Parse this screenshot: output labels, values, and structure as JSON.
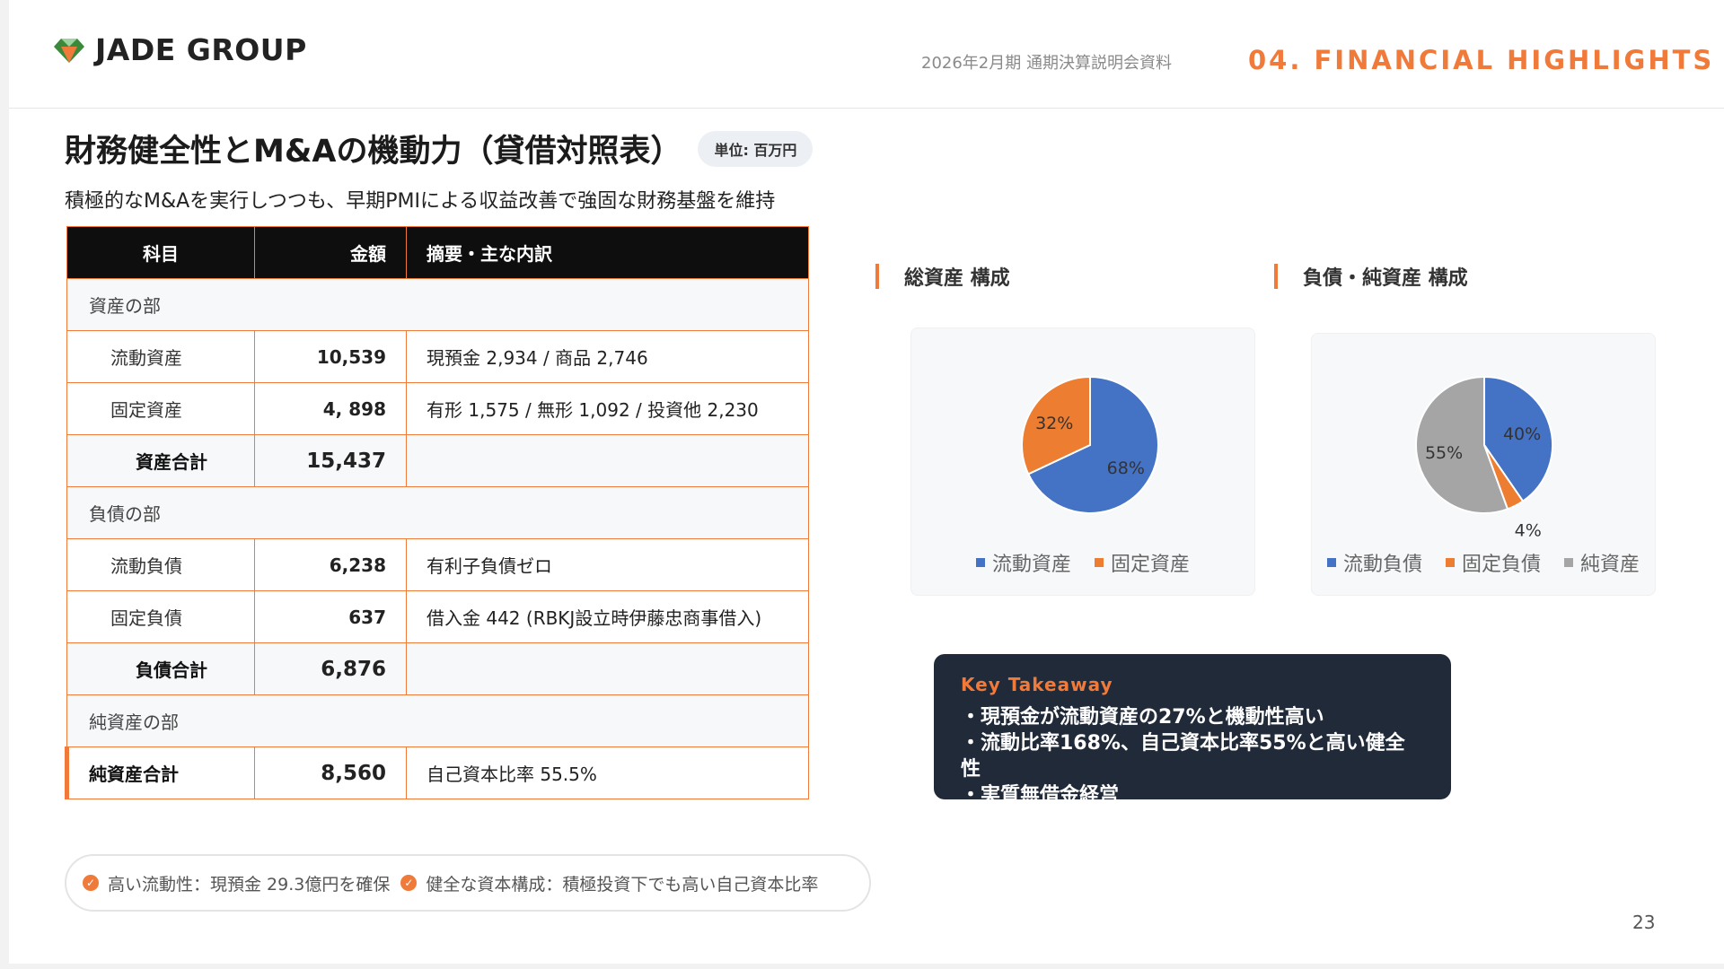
{
  "header": {
    "logo_text": "JADE GROUP",
    "doc_title": "2026年2月期 通期決算説明会資料",
    "section_label": "04. FINANCIAL HIGHLIGHTS"
  },
  "page": {
    "title": "財務健全性とM&Aの機動力（貸借対照表）",
    "unit": "単位: 百万円",
    "subtitle": "積極的なM&Aを実行しつつも、早期PMIによる収益改善で強固な財務基盤を維持",
    "page_number": "23"
  },
  "table": {
    "headers": [
      "科目",
      "金額",
      "摘要・主な内訳"
    ],
    "assets_section": "資産の部",
    "current_assets": {
      "name": "流動資産",
      "amount": "10,539",
      "detail": "現預金 2,934 / 商品 2,746"
    },
    "fixed_assets": {
      "name": "固定資産",
      "amount": "4, 898",
      "detail": "有形 1,575 / 無形 1,092 / 投資他 2,230"
    },
    "total_assets": {
      "name": "資産合計",
      "amount": "15,437"
    },
    "liabilities_section": "負債の部",
    "current_liabilities": {
      "name": "流動負債",
      "amount": "6,238",
      "detail": "有利子負債ゼロ"
    },
    "fixed_liabilities": {
      "name": "固定負債",
      "amount": "637",
      "detail": "借入金 442 (RBKJ設立時伊藤忠商事借入)"
    },
    "total_liabilities": {
      "name": "負債合計",
      "amount": "6,876"
    },
    "net_assets_section": "純資産の部",
    "total_net_assets": {
      "name": "純資産合計",
      "amount": "8,560",
      "detail": "自己資本比率 55.5%"
    }
  },
  "notes": {
    "item1": "高い流動性：現預金 29.3億円を確保",
    "item2": "健全な資本構成：積極投資下でも高い自己資本比率"
  },
  "takeaway": {
    "title": "Key Takeaway",
    "line1": "・現預金が流動資産の27%と機動性高い",
    "line2": "・流動比率168%、自己資本比率55%と高い健全性",
    "line3": "・実質無借金経営"
  },
  "chart_data": [
    {
      "type": "pie",
      "title": "総資産 構成",
      "categories": [
        "流動資産",
        "固定資産"
      ],
      "values": [
        68,
        32
      ],
      "labels": [
        "68%",
        "32%"
      ],
      "colors": [
        "#4472c4",
        "#ed7d31"
      ],
      "legend": "bottom"
    },
    {
      "type": "pie",
      "title": "負債・純資産 構成",
      "categories": [
        "流動負債",
        "固定負債",
        "純資産"
      ],
      "values": [
        40,
        4,
        55
      ],
      "labels": [
        "40%",
        "4%",
        "55%"
      ],
      "colors": [
        "#4472c4",
        "#ed7d31",
        "#a5a5a5"
      ],
      "legend": "bottom"
    }
  ]
}
